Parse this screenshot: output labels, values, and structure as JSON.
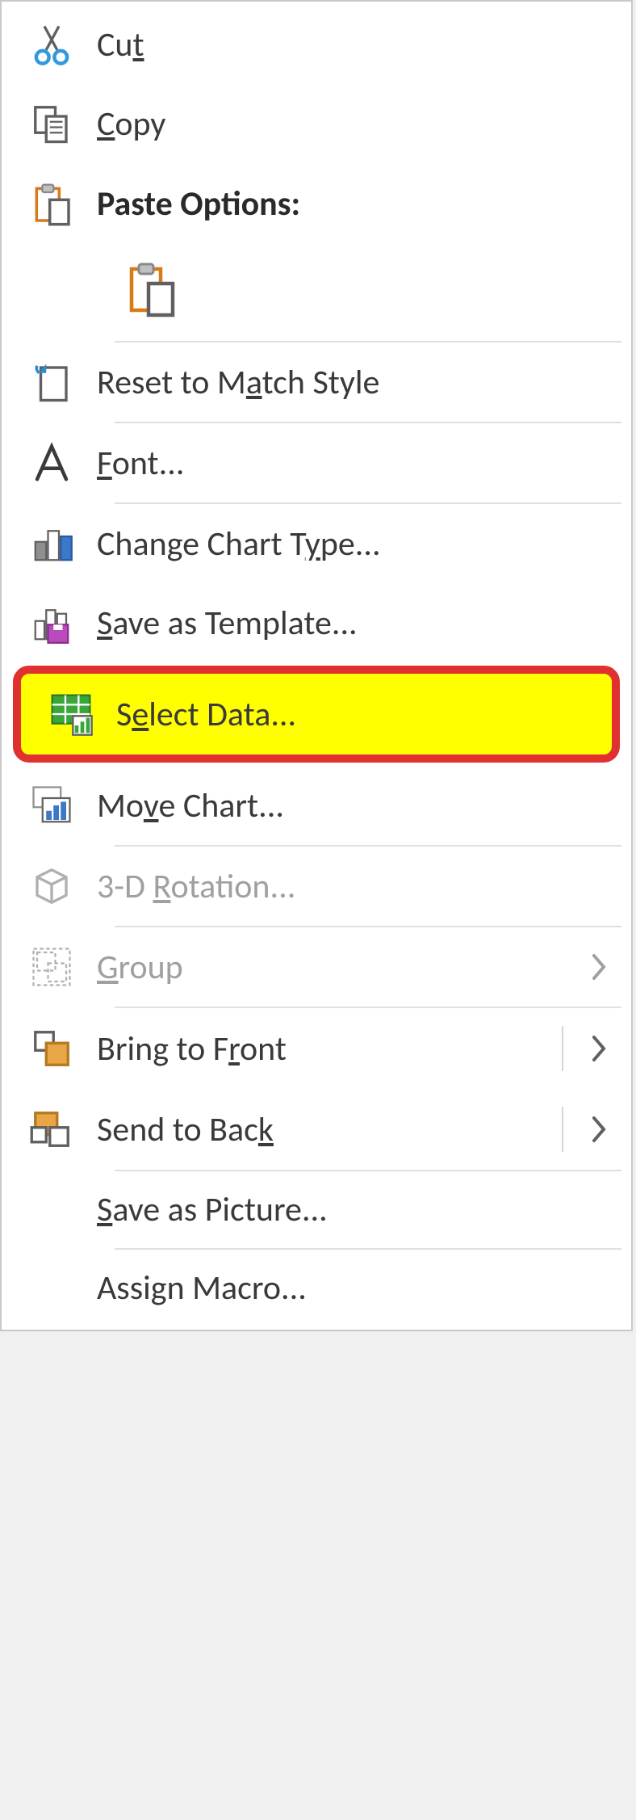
{
  "menu": {
    "cut": {
      "pre": "Cu",
      "u": "t",
      "post": ""
    },
    "copy": {
      "pre": "",
      "u": "C",
      "post": "opy"
    },
    "paste_options_label": "Paste Options:",
    "reset_match": {
      "pre": "Reset to M",
      "u": "a",
      "post": "tch Style"
    },
    "font": {
      "pre": "",
      "u": "F",
      "post": "ont..."
    },
    "change_chart_type": {
      "pre": "Change Chart T",
      "u": "y",
      "post": "pe..."
    },
    "save_template": {
      "pre": "",
      "u": "S",
      "post": "ave as Template..."
    },
    "select_data": {
      "pre": "S",
      "u": "e",
      "post": "lect Data..."
    },
    "move_chart": {
      "pre": "Mo",
      "u": "v",
      "post": "e Chart..."
    },
    "rotation3d": {
      "pre": "3-D ",
      "u": "R",
      "post": "otation..."
    },
    "group": {
      "pre": "",
      "u": "G",
      "post": "roup"
    },
    "bring_front": {
      "pre": "Bring to F",
      "u": "r",
      "post": "ont"
    },
    "send_back": {
      "pre": "Send to Bac",
      "u": "k",
      "post": ""
    },
    "save_picture": {
      "pre": "",
      "u": "S",
      "post": "ave as Picture..."
    },
    "assign_macro": {
      "pre": "Assi",
      "u": "g",
      "post": "n Macro..."
    }
  }
}
